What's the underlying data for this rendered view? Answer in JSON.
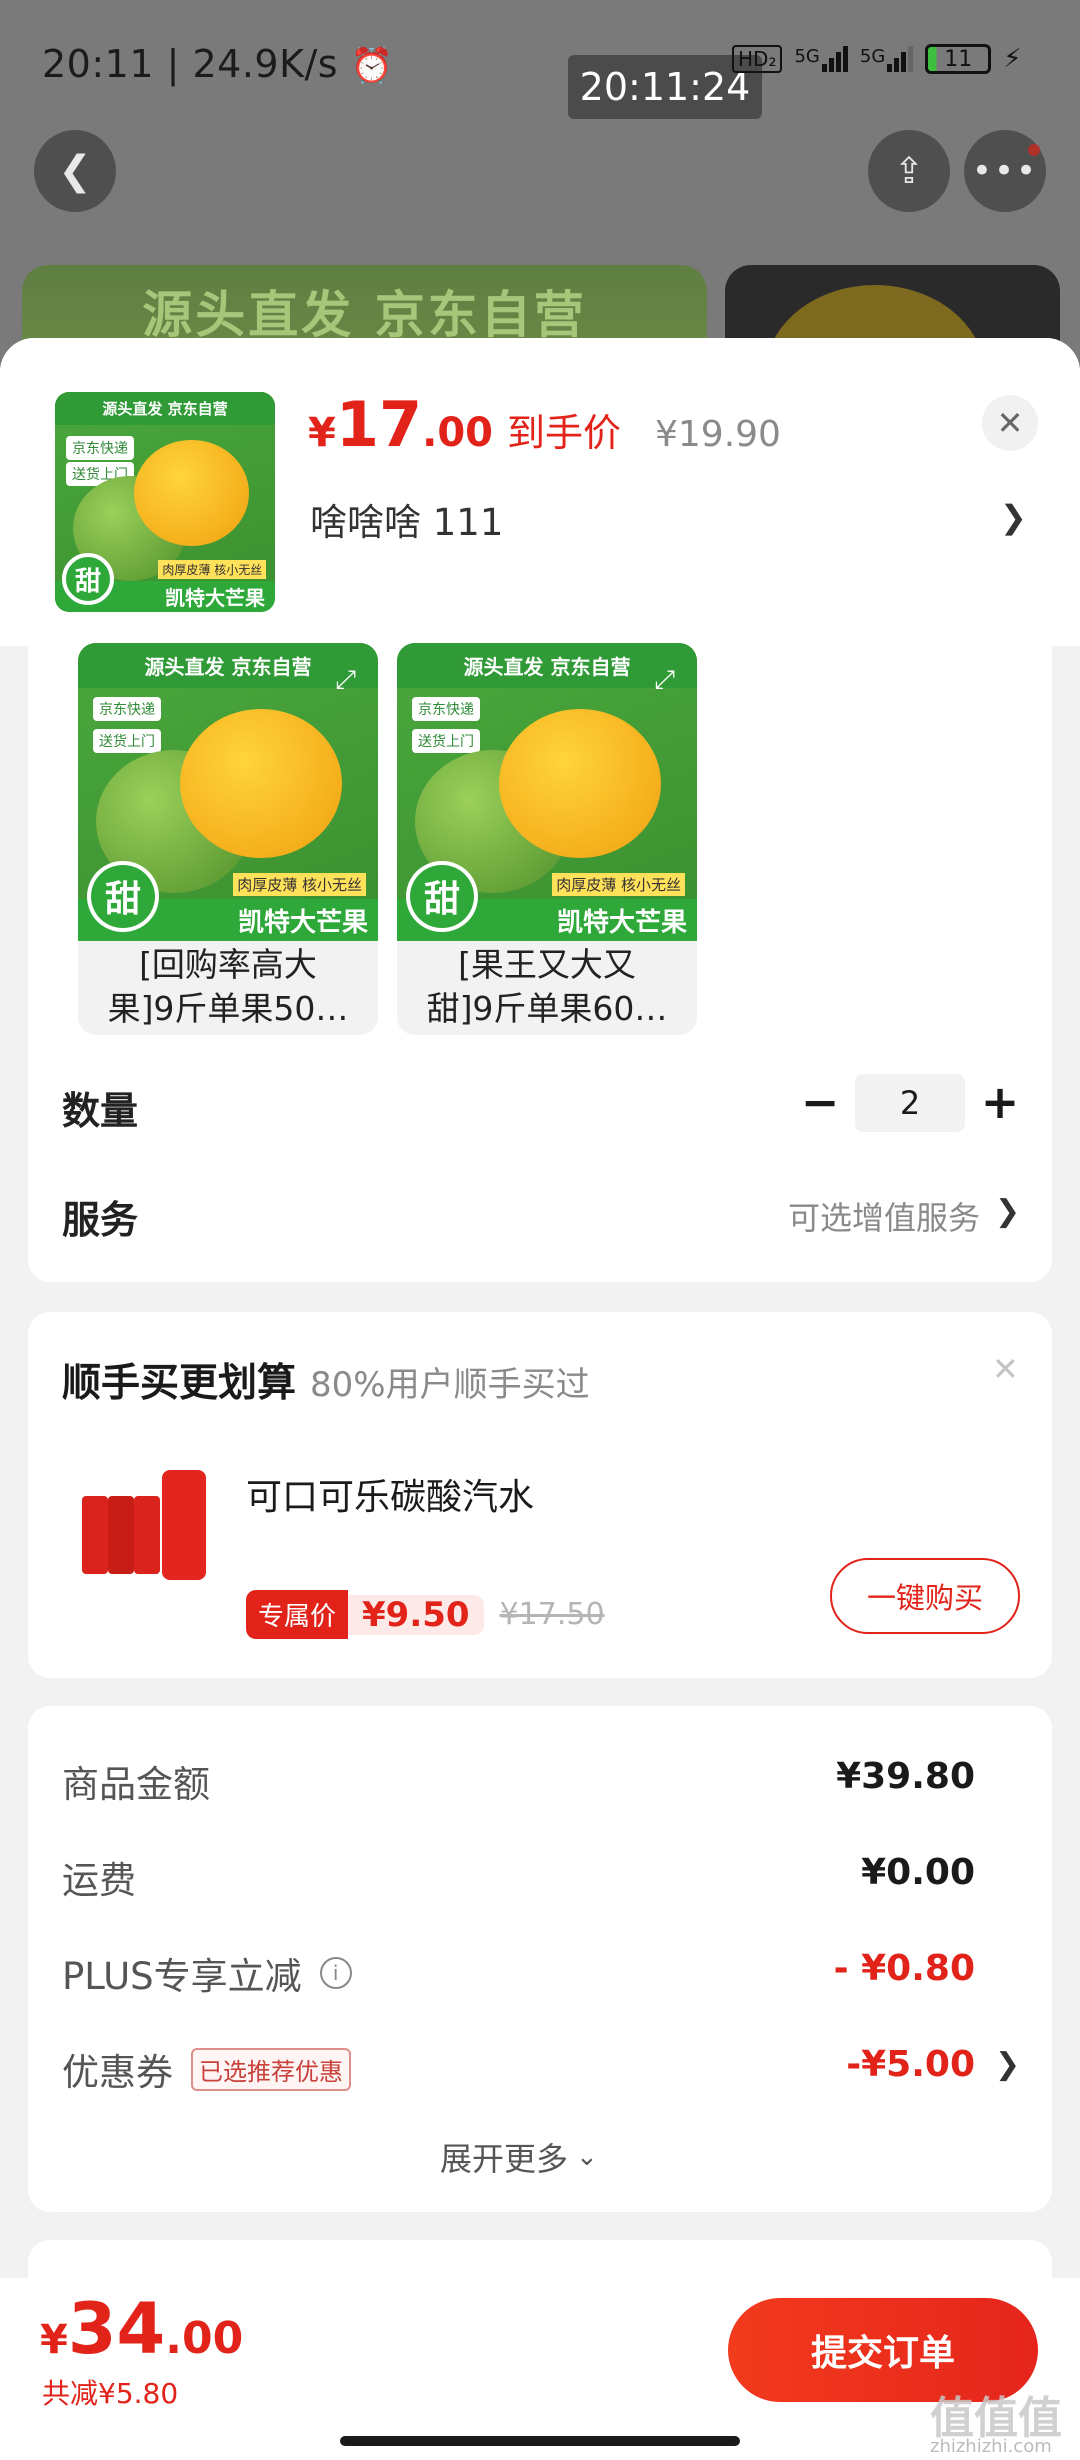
{
  "status": {
    "time_speed": "20:11 | 24.9K/s",
    "alarm_icon": "alarm-icon",
    "clock_chip": "20:11:24",
    "hd": "HD₂",
    "net1": "5G",
    "net2": "5G",
    "battery": "11"
  },
  "banner": {
    "text": "源头直发 京东自营"
  },
  "product": {
    "price_symbol": "¥",
    "price_int": "17",
    "price_dec": ".00",
    "price_tag": "到手价",
    "orig_price": "¥19.90",
    "variant_text": "啥啥啥  111",
    "thumb": {
      "header": "源头直发 京东自营",
      "pill1": "京东快递",
      "pill2": "送货上门",
      "sub": "肉厚皮薄 核小无丝",
      "footer": "凯特大芒果",
      "sweet": "甜"
    }
  },
  "options": [
    {
      "line1": "[回购率高大",
      "line2": "果]9斤单果50…"
    },
    {
      "line1": "[果王又大又",
      "line2": "甜]9斤单果60…"
    }
  ],
  "quantity": {
    "label": "数量",
    "value": "2",
    "minus": "−",
    "plus": "+"
  },
  "service": {
    "label": "服务",
    "value": "可选增值服务"
  },
  "addon": {
    "title": "顺手买更划算",
    "subtitle": "80%用户顺手买过",
    "item_name": "可口可乐碳酸汽水",
    "badge": "专属价",
    "price": "¥9.50",
    "orig": "¥17.50",
    "buy_label": "一键购买"
  },
  "fees": {
    "goods_label": "商品金额",
    "goods_val": "¥39.80",
    "ship_label": "运费",
    "ship_val": "¥0.00",
    "plus_label": "PLUS专享立减",
    "plus_val": "- ¥0.80",
    "coupon_label": "优惠券",
    "coupon_tag": "已选推荐优惠",
    "coupon_val": "-¥5.00",
    "expand": "展开更多"
  },
  "footer": {
    "total_symbol": "¥",
    "total_int": "34",
    "total_dec": ".00",
    "saved": "共减¥5.80",
    "submit": "提交订单"
  },
  "watermark": {
    "logo": "值值值",
    "url": "zhizhizhi.com"
  },
  "colors": {
    "accent": "#e2231a",
    "sheet_bg": "#f2f2f2"
  }
}
